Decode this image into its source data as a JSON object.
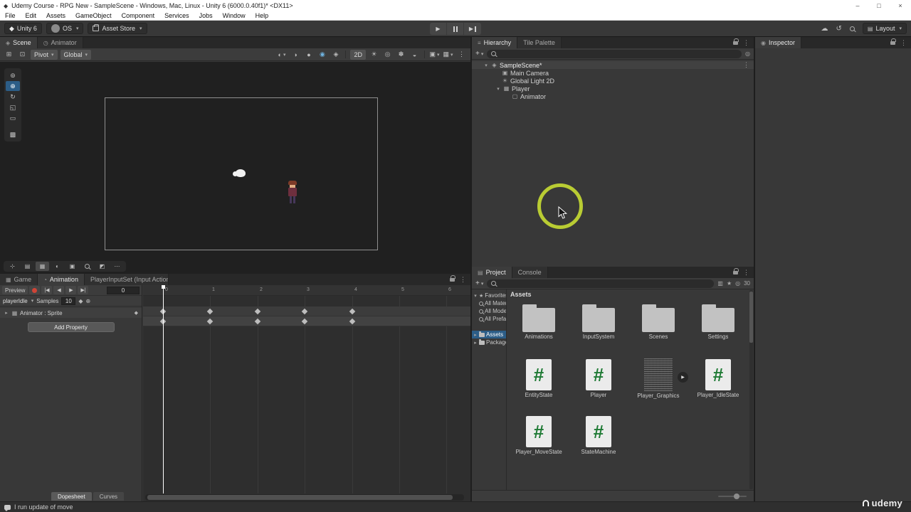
{
  "titlebar": {
    "title": "Udemy Course - RPG New - SampleScene - Windows, Mac, Linux - Unity 6 (6000.0.40f1)* <DX11>",
    "controls": {
      "minimize": "–",
      "maximize": "□",
      "close": "×"
    }
  },
  "menubar": {
    "items": [
      "File",
      "Edit",
      "Assets",
      "GameObject",
      "Component",
      "Services",
      "Jobs",
      "Window",
      "Help"
    ]
  },
  "toolbar": {
    "unity_version": "Unity 6",
    "account": "OS",
    "asset_store": "Asset Store",
    "layout": "Layout"
  },
  "scene_panel": {
    "tabs": [
      "Scene",
      "Animator"
    ],
    "toolbar": {
      "pivot": "Pivot",
      "global": "Global",
      "view_2d": "2D"
    }
  },
  "hierarchy": {
    "tabs": [
      "Hierarchy",
      "Tile Palette"
    ],
    "create_button": "+",
    "items": [
      {
        "label": "SampleScene*",
        "depth": 0,
        "icon": "unity-scene"
      },
      {
        "label": "Main Camera",
        "depth": 1,
        "icon": "camera"
      },
      {
        "label": "Global Light 2D",
        "depth": 1,
        "icon": "light"
      },
      {
        "label": "Player",
        "depth": 1,
        "icon": "gameobject"
      },
      {
        "label": "Animator",
        "depth": 2,
        "icon": "gameobject"
      }
    ]
  },
  "inspector": {
    "tab": "Inspector"
  },
  "project": {
    "tabs": [
      "Project",
      "Console"
    ],
    "create_button": "+",
    "hidden_count": "30",
    "favorites_label": "Favorites",
    "favorites": [
      "All Materials",
      "All Models",
      "All Prefabs"
    ],
    "roots": [
      "Assets",
      "Packages"
    ],
    "breadcrumb": "Assets",
    "items": [
      {
        "name": "Animations",
        "type": "folder"
      },
      {
        "name": "InputSystem",
        "type": "folder"
      },
      {
        "name": "Scenes",
        "type": "folder"
      },
      {
        "name": "Settings",
        "type": "folder"
      },
      {
        "name": "EntityState",
        "type": "script"
      },
      {
        "name": "Player",
        "type": "script"
      },
      {
        "name": "Player_Graphics",
        "type": "texture"
      },
      {
        "name": "Player_IdleState",
        "type": "script"
      },
      {
        "name": "Player_MoveState",
        "type": "script"
      },
      {
        "name": "StateMachine",
        "type": "script"
      }
    ]
  },
  "animation": {
    "tabs": [
      "Game",
      "Animation",
      "PlayerInputSet (Input Actions Ed"
    ],
    "preview": "Preview",
    "frame": "0",
    "clip": "playerIdle",
    "samples_label": "Samples",
    "samples": "10",
    "property": "Animator : Sprite",
    "add_property": "Add Property",
    "dopesheet_tab": "Dopesheet",
    "curves_tab": "Curves",
    "ruler_ticks": [
      "0",
      "1",
      "2",
      "3",
      "4",
      "5",
      "6"
    ],
    "keyframe_frames": [
      0,
      1,
      2,
      3,
      4
    ]
  },
  "statusbar": {
    "message": "I run update of move"
  },
  "watermark": "udemy",
  "colors": {
    "selection_blue": "#2C5D87",
    "click_ring": "#B9CC33",
    "record_red": "#D04436",
    "script_green": "#1E7A34"
  }
}
